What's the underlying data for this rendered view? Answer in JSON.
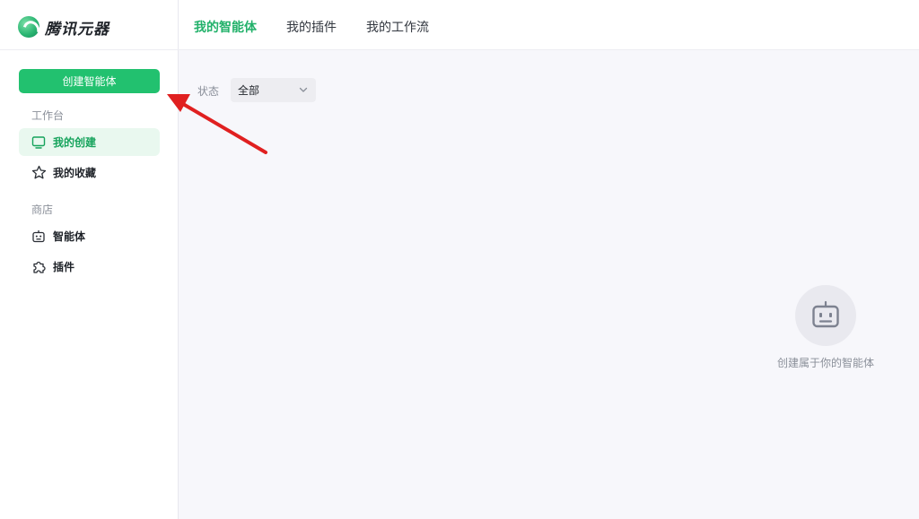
{
  "app": {
    "name": "腾讯元器"
  },
  "header": {
    "tabs": [
      {
        "label": "我的智能体",
        "active": true
      },
      {
        "label": "我的插件",
        "active": false
      },
      {
        "label": "我的工作流",
        "active": false
      }
    ]
  },
  "sidebar": {
    "create_button": "创建智能体",
    "workspace_label": "工作台",
    "workspace_items": [
      {
        "label": "我的创建",
        "icon": "monitor-icon",
        "active": true
      },
      {
        "label": "我的收藏",
        "icon": "star-icon",
        "active": false
      }
    ],
    "store_label": "商店",
    "store_items": [
      {
        "label": "智能体",
        "icon": "robot-icon"
      },
      {
        "label": "插件",
        "icon": "puzzle-icon"
      }
    ]
  },
  "filter": {
    "label": "状态",
    "value": "全部"
  },
  "empty_state": {
    "text": "创建属于你的智能体"
  },
  "colors": {
    "accent": "#22c16f",
    "annotation_arrow": "#e02020"
  }
}
